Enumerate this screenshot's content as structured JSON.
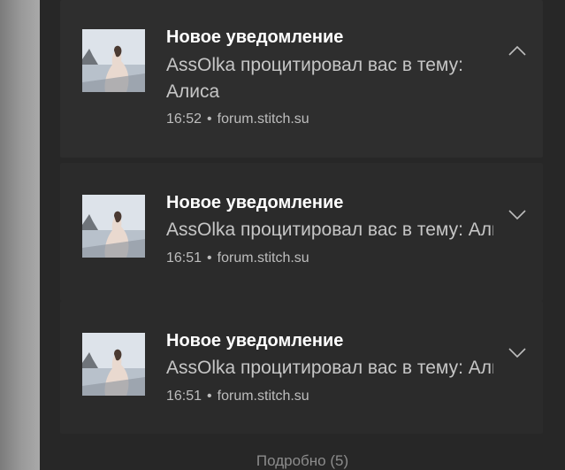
{
  "notifications": [
    {
      "title": "Новое уведомление",
      "message": "AssOlka процитировал вас в тему: Алиса",
      "time": "16:52",
      "source": "forum.stitch.su",
      "chevron_icon": "chevron-up-icon"
    },
    {
      "title": "Новое уведомление",
      "message": "AssOlka процитировал вас в тему: Алиса",
      "time": "16:51",
      "source": "forum.stitch.su",
      "chevron_icon": "chevron-down-icon"
    },
    {
      "title": "Новое уведомление",
      "message": "AssOlka процитировал вас в тему: Алиса",
      "time": "16:51",
      "source": "forum.stitch.su",
      "chevron_icon": "chevron-down-icon"
    }
  ],
  "separator": "•",
  "footer": {
    "more_label": "Подробно (5)"
  }
}
